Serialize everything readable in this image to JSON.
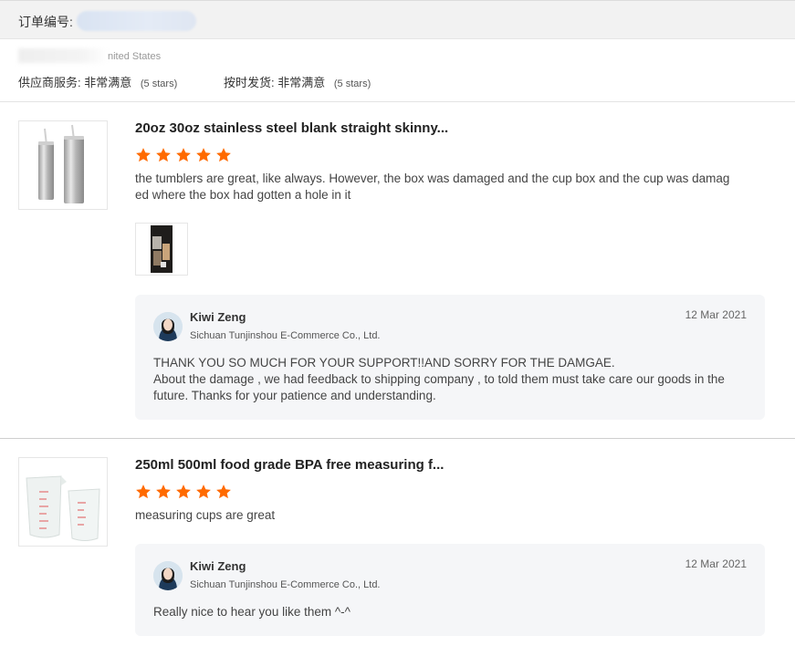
{
  "header": {
    "order_label": "订单编号:"
  },
  "buyer": {
    "location": "nited States",
    "supplier_service_label": "供应商服务:",
    "supplier_service_value": "非常满意",
    "supplier_service_stars": "(5 stars)",
    "ontime_label": "按时发货:",
    "ontime_value": "非常满意",
    "ontime_stars": "(5 stars)"
  },
  "colors": {
    "star": "#ff6a00",
    "reply_bg": "#f5f6f8"
  },
  "reviews": [
    {
      "product_title": "20oz 30oz stainless steel blank straight skinny...",
      "rating": 5,
      "text": "the tumblers are great, like always. However, the box was damaged and the cup box and the cup was damaged where the box had gotten a hole in it",
      "reply": {
        "name": "Kiwi Zeng",
        "company": "Sichuan Tunjinshou E-Commerce Co., Ltd.",
        "date": "12 Mar 2021",
        "lines": [
          "THANK YOU SO MUCH FOR YOUR SUPPORT!!AND SORRY FOR THE DAMGAE.",
          "About the damage , we had feedback to shipping company , to told them must take care our goods in the future. Thanks for your patience and understanding."
        ]
      }
    },
    {
      "product_title": "250ml 500ml food grade BPA free measuring f...",
      "rating": 5,
      "text": "measuring cups are great",
      "reply": {
        "name": "Kiwi Zeng",
        "company": "Sichuan Tunjinshou E-Commerce Co., Ltd.",
        "date": "12 Mar 2021",
        "lines": [
          "Really nice to hear you like them ^-^"
        ]
      }
    }
  ]
}
